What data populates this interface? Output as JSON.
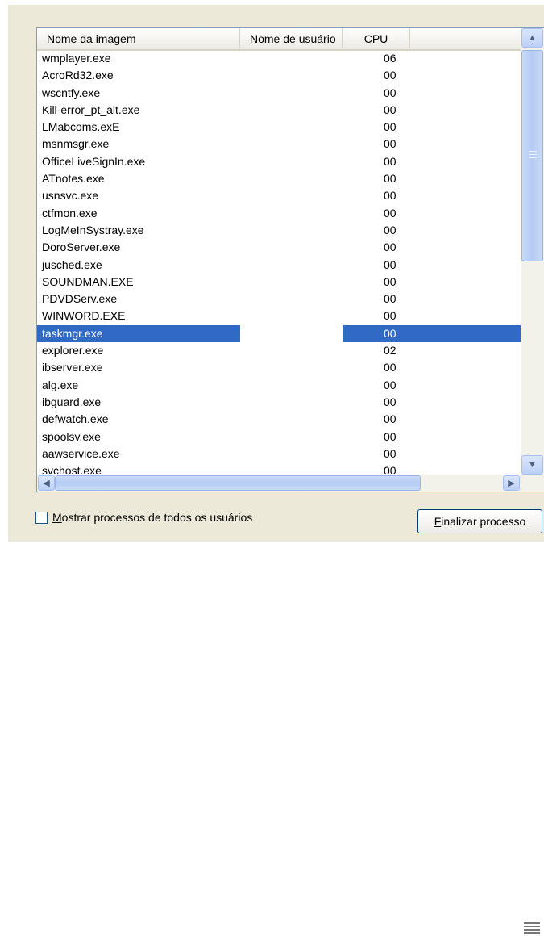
{
  "columns": {
    "name": "Nome da imagem",
    "user": "Nome de usuário",
    "cpu": "CPU"
  },
  "processes": [
    {
      "name": "wmplayer.exe",
      "user": "",
      "cpu": "06"
    },
    {
      "name": "AcroRd32.exe",
      "user": "",
      "cpu": "00"
    },
    {
      "name": "wscntfy.exe",
      "user": "",
      "cpu": "00"
    },
    {
      "name": "Kill-error_pt_alt.exe",
      "user": "",
      "cpu": "00"
    },
    {
      "name": "LMabcoms.exE",
      "user": "",
      "cpu": "00"
    },
    {
      "name": "msnmsgr.exe",
      "user": "",
      "cpu": "00"
    },
    {
      "name": "OfficeLiveSignIn.exe",
      "user": "",
      "cpu": "00"
    },
    {
      "name": "ATnotes.exe",
      "user": "",
      "cpu": "00"
    },
    {
      "name": "usnsvc.exe",
      "user": "",
      "cpu": "00"
    },
    {
      "name": "ctfmon.exe",
      "user": "",
      "cpu": "00"
    },
    {
      "name": "LogMeInSystray.exe",
      "user": "",
      "cpu": "00"
    },
    {
      "name": "DoroServer.exe",
      "user": "",
      "cpu": "00"
    },
    {
      "name": "jusched.exe",
      "user": "",
      "cpu": "00"
    },
    {
      "name": "SOUNDMAN.EXE",
      "user": "",
      "cpu": "00"
    },
    {
      "name": "PDVDServ.exe",
      "user": "",
      "cpu": "00"
    },
    {
      "name": "WINWORD.EXE",
      "user": "",
      "cpu": "00"
    },
    {
      "name": "taskmgr.exe",
      "user": "",
      "cpu": "00",
      "selected": true
    },
    {
      "name": "explorer.exe",
      "user": "",
      "cpu": "02"
    },
    {
      "name": "ibserver.exe",
      "user": "",
      "cpu": "00"
    },
    {
      "name": "alg.exe",
      "user": "",
      "cpu": "00"
    },
    {
      "name": "ibguard.exe",
      "user": "",
      "cpu": "00"
    },
    {
      "name": "defwatch.exe",
      "user": "",
      "cpu": "00"
    },
    {
      "name": "spoolsv.exe",
      "user": "",
      "cpu": "00"
    },
    {
      "name": "aawservice.exe",
      "user": "",
      "cpu": "00"
    },
    {
      "name": "svchost.exe",
      "user": "",
      "cpu": "00"
    }
  ],
  "show_all_users": {
    "accel": "M",
    "rest": "ostrar processos de todos os usuários",
    "checked": false
  },
  "end_process": {
    "accel": "F",
    "rest": "inalizar processo"
  },
  "icons": {
    "scroll_up": "▲",
    "scroll_down": "▼",
    "scroll_left": "◀",
    "scroll_right": "▶"
  },
  "colors": {
    "selection": "#316ac5",
    "panel": "#ece9d8"
  }
}
